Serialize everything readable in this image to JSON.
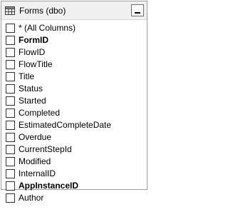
{
  "window": {
    "title": "Forms (dbo)",
    "icon": "table-icon",
    "minimize_icon": "minimize-icon"
  },
  "columns": [
    {
      "label": "* (All Columns)",
      "key": false,
      "checked": false
    },
    {
      "label": "FormID",
      "key": true,
      "checked": false
    },
    {
      "label": "FlowID",
      "key": false,
      "checked": false
    },
    {
      "label": "FlowTitle",
      "key": false,
      "checked": false
    },
    {
      "label": "Title",
      "key": false,
      "checked": false
    },
    {
      "label": "Status",
      "key": false,
      "checked": false
    },
    {
      "label": "Started",
      "key": false,
      "checked": false
    },
    {
      "label": "Completed",
      "key": false,
      "checked": false
    },
    {
      "label": "EstimatedCompleteDate",
      "key": false,
      "checked": false
    },
    {
      "label": "Overdue",
      "key": false,
      "checked": false
    },
    {
      "label": "CurrentStepId",
      "key": false,
      "checked": false
    },
    {
      "label": "Modified",
      "key": false,
      "checked": false
    },
    {
      "label": "InternalID",
      "key": false,
      "checked": false
    },
    {
      "label": "AppInstanceID",
      "key": true,
      "checked": false
    },
    {
      "label": "Author",
      "key": false,
      "checked": false
    }
  ]
}
